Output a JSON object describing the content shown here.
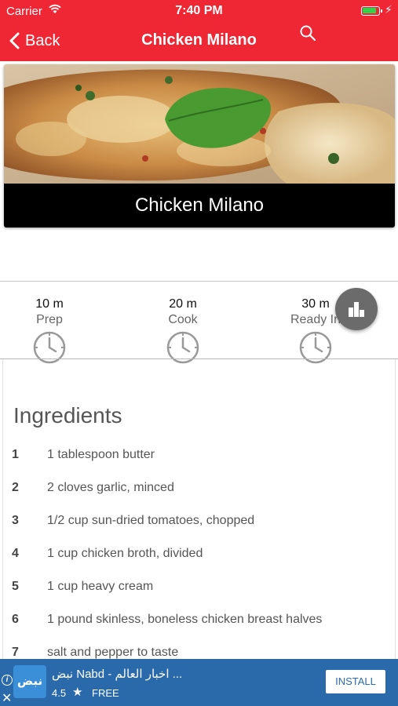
{
  "status_bar": {
    "carrier": "Carrier",
    "time": "7:40 PM",
    "wifi_icon": "wifi-icon",
    "battery_icon": "battery-icon",
    "charging_icon": "bolt-icon"
  },
  "nav": {
    "back_label": "Back",
    "title": "Chicken Milano",
    "search_icon": "search-icon",
    "color": "#ef2634"
  },
  "hero": {
    "caption": "Chicken Milano"
  },
  "times": {
    "prep": {
      "value": "10 m",
      "label": "Prep"
    },
    "cook": {
      "value": "20 m",
      "label": "Cook"
    },
    "ready": {
      "value": "30 m",
      "label": "Ready In"
    },
    "stats_icon": "bar-chart-icon"
  },
  "ingredients": {
    "title": "Ingredients",
    "items": [
      {
        "num": "1",
        "text": "1 tablespoon butter"
      },
      {
        "num": "2",
        "text": "2 cloves garlic, minced"
      },
      {
        "num": "3",
        "text": "1/2 cup sun-dried tomatoes, chopped"
      },
      {
        "num": "4",
        "text": "1 cup chicken broth, divided"
      },
      {
        "num": "5",
        "text": "1 cup heavy cream"
      },
      {
        "num": "6",
        "text": "1 pound skinless, boneless chicken breast halves"
      },
      {
        "num": "7",
        "text": "salt and pepper to taste"
      }
    ]
  },
  "ad": {
    "logo_text": "نبض",
    "title": "نبض Nabd - اخبار العالم ...",
    "rating": "4.5",
    "price": "FREE",
    "install_label": "INSTALL",
    "color": "#2a6aab"
  }
}
